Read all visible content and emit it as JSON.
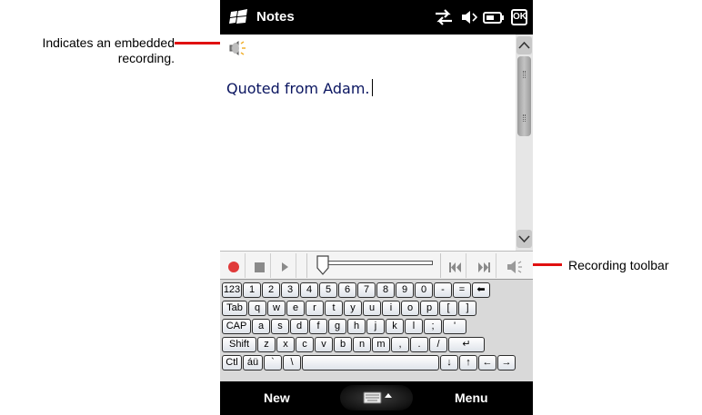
{
  "callouts": {
    "embedded_recording": "Indicates an embedded recording.",
    "recording_toolbar": "Recording toolbar",
    "line_color": "#e01010"
  },
  "titlebar": {
    "title": "Notes",
    "logo_icon": "windows-flag-icon",
    "status_icons": [
      "connectivity-icon",
      "speaker-muted-icon",
      "battery-icon"
    ],
    "ok_label": "OK"
  },
  "note": {
    "text": "Quoted from Adam.",
    "text_color": "#0a1560",
    "recording_icon": "speaker-recording-icon"
  },
  "recording_toolbar": {
    "buttons": [
      "record-icon",
      "stop-icon",
      "play-icon",
      "previous-icon",
      "next-icon",
      "volume-icon"
    ],
    "record_color": "#e03a3a"
  },
  "keyboard": {
    "rows": [
      [
        "123",
        "1",
        "2",
        "3",
        "4",
        "5",
        "6",
        "7",
        "8",
        "9",
        "0",
        "-",
        "=",
        "⬅"
      ],
      [
        "Tab",
        "q",
        "w",
        "e",
        "r",
        "t",
        "y",
        "u",
        "i",
        "o",
        "p",
        "[",
        "]"
      ],
      [
        "CAP",
        "a",
        "s",
        "d",
        "f",
        "g",
        "h",
        "j",
        "k",
        "l",
        ";",
        "'"
      ],
      [
        "Shift",
        "z",
        "x",
        "c",
        "v",
        "b",
        "n",
        "m",
        ",",
        ".",
        "/",
        "↵"
      ],
      [
        "Ctl",
        "áü",
        "`",
        "\\",
        "",
        "↓",
        "↑",
        "←",
        "→"
      ]
    ]
  },
  "softkeys": {
    "left": "New",
    "right": "Menu",
    "input_panel_icon": "keyboard-icon"
  }
}
